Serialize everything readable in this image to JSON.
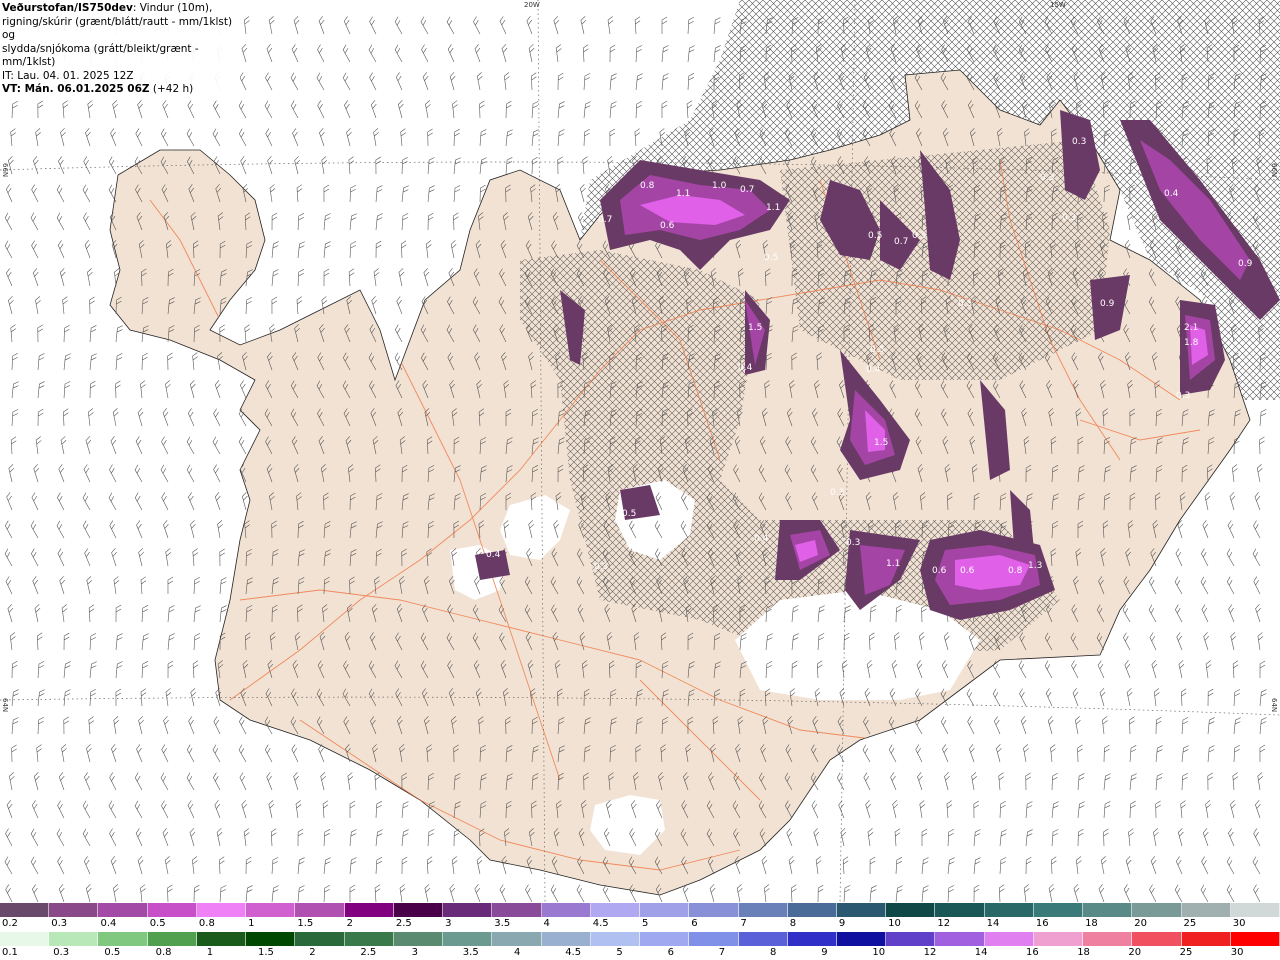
{
  "header": {
    "title": "Veðurstofan/IS750dev",
    "desc1": ": Vindur (10m),",
    "desc2": "rigning/skúrir (grænt/blátt/rautt - mm/1klst) og",
    "desc3": "slydda/snjókoma (grátt/bleikt/grænt - mm/1klst)",
    "issue": "IT: Lau. 04. 01. 2025 12Z",
    "valid_bold": "VT: Mán. 06.01.2025 06Z",
    "valid_lead": " (+42 h)"
  },
  "graticule": {
    "top_lon": [
      "20W",
      "15W"
    ],
    "left_lat": [
      "66N",
      "64N"
    ],
    "right_lat": [
      "66N",
      "64N"
    ]
  },
  "colors": {
    "land": "#f2e2d3",
    "road": "#f08050",
    "snow_dark": "#6a3a66",
    "snow_mid": "#a445a6",
    "snow_bright": "#e060e8",
    "snow_pale": "#f5a0f5",
    "glacier": "#ffffff"
  },
  "precip_labels": [
    "0.8",
    "1.1",
    "1.0",
    "0.7",
    "1.1",
    "0.7",
    "0.6",
    "0.5",
    "0.5",
    "0.7",
    "0.5",
    "0.3",
    "0.3",
    "0.3",
    "0.4",
    "0.9",
    "0.9",
    "1.5",
    "0.4",
    "0.3",
    "0.5",
    "0.4",
    "0.3",
    "0.6",
    "0.6",
    "0.8",
    "1.3",
    "2.1",
    "1.8",
    "0.3",
    "1.5",
    "0.4",
    "0.5",
    "0.4",
    "0.3",
    "1.1",
    "0.5"
  ],
  "legend": {
    "snow": {
      "labels": [
        "0.2",
        "0.3",
        "0.4",
        "0.5",
        "0.8",
        "1",
        "1.5",
        "2",
        "2.5",
        "3",
        "3.5",
        "4",
        "4.5",
        "5",
        "6",
        "7",
        "8",
        "9",
        "10",
        "12",
        "14",
        "16",
        "18",
        "20",
        "25",
        "30"
      ],
      "colors": [
        "#6a4a6a",
        "#8a4a8a",
        "#a34aa6",
        "#c750c9",
        "#f080f5",
        "#d060d0",
        "#b050b0",
        "#800080",
        "#4a0048",
        "#6a2a7a",
        "#8a4a9a",
        "#9a7ad0",
        "#b0a8f0",
        "#a0a0e8",
        "#8890d8",
        "#6a80b8",
        "#4a6a98",
        "#2a5870",
        "#104848",
        "#1a5858",
        "#2a6868",
        "#3a7a78",
        "#5a8a88",
        "#7a9a98",
        "#a0b0b0",
        "#d0d8d8"
      ]
    },
    "rain": {
      "labels": [
        "0.1",
        "0.3",
        "0.5",
        "0.8",
        "1",
        "1.5",
        "2",
        "2.5",
        "3",
        "3.5",
        "4",
        "4.5",
        "5",
        "6",
        "7",
        "8",
        "9",
        "10",
        "12",
        "14",
        "16",
        "18",
        "20",
        "25",
        "30"
      ],
      "colors": [
        "#e8f8e8",
        "#b8e8b8",
        "#80c880",
        "#50a050",
        "#1a5a1a",
        "#004800",
        "#2a6a3a",
        "#3a7a4a",
        "#5a8a70",
        "#6a9a90",
        "#8aa8b0",
        "#9ab0d0",
        "#b0c0f0",
        "#a0a8f0",
        "#8090e8",
        "#5a60d8",
        "#3030c8",
        "#1010a0",
        "#6040c8",
        "#a060e0",
        "#e080f0",
        "#f0a0d0",
        "#f080a0",
        "#f05060",
        "#f02020",
        "#ff0000"
      ]
    }
  }
}
